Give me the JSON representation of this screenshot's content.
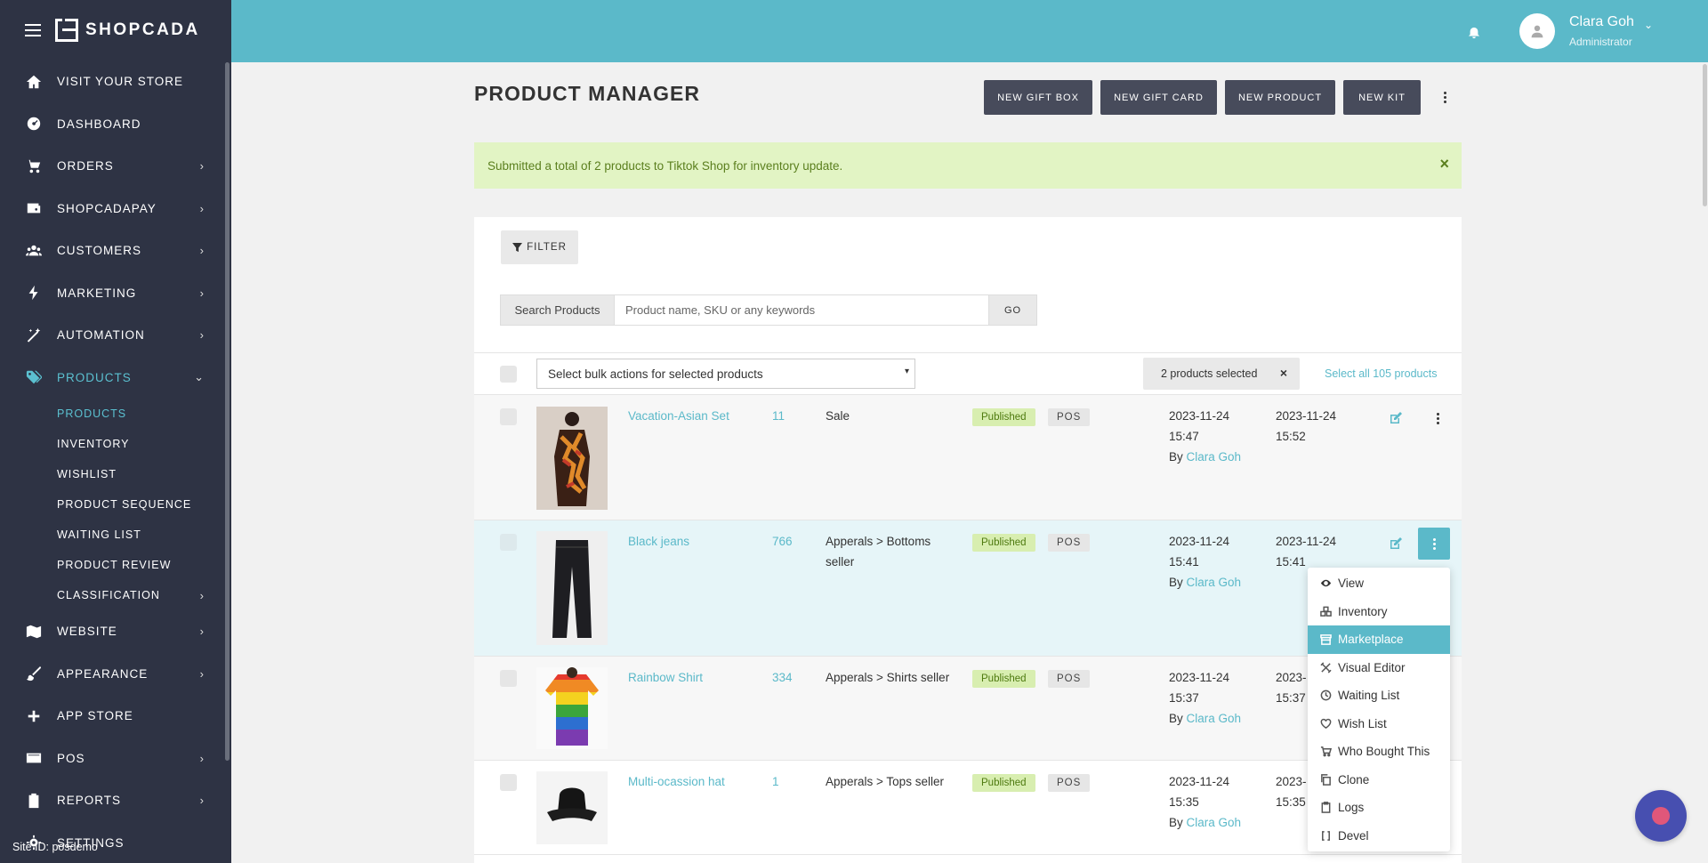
{
  "brand": {
    "name": "SHOPCADA"
  },
  "sidebar": {
    "items": [
      {
        "label": "VISIT YOUR STORE",
        "icon": "home-icon",
        "chevron": false
      },
      {
        "label": "DASHBOARD",
        "icon": "dashboard-icon",
        "chevron": false
      },
      {
        "label": "ORDERS",
        "icon": "cart-icon",
        "chevron": true
      },
      {
        "label": "SHOPCADAPAY",
        "icon": "wallet-icon",
        "chevron": true
      },
      {
        "label": "CUSTOMERS",
        "icon": "users-icon",
        "chevron": true
      },
      {
        "label": "MARKETING",
        "icon": "bolt-icon",
        "chevron": true
      },
      {
        "label": "AUTOMATION",
        "icon": "wand-icon",
        "chevron": true
      },
      {
        "label": "PRODUCTS",
        "icon": "tags-icon",
        "chevron": true,
        "active": true
      }
    ],
    "sub_items": [
      {
        "label": "PRODUCTS",
        "active": true
      },
      {
        "label": "INVENTORY"
      },
      {
        "label": "WISHLIST"
      },
      {
        "label": "PRODUCT SEQUENCE"
      },
      {
        "label": "WAITING LIST"
      },
      {
        "label": "PRODUCT REVIEW"
      },
      {
        "label": "CLASSIFICATION",
        "chevron": true
      }
    ],
    "items_after": [
      {
        "label": "WEBSITE",
        "icon": "map-icon",
        "chevron": true
      },
      {
        "label": "APPEARANCE",
        "icon": "brush-icon",
        "chevron": true
      },
      {
        "label": "APP STORE",
        "icon": "plus-icon",
        "chevron": false
      },
      {
        "label": "POS",
        "icon": "card-icon",
        "chevron": true
      },
      {
        "label": "REPORTS",
        "icon": "clipboard-icon",
        "chevron": true
      },
      {
        "label": "SETTINGS",
        "icon": "gear-icon",
        "chevron": false
      }
    ],
    "site_id": "Site ID: posdemo"
  },
  "header": {
    "user_name": "Clara Goh",
    "user_role": "Administrator"
  },
  "page": {
    "title": "PRODUCT MANAGER",
    "buttons": [
      "NEW GIFT BOX",
      "NEW GIFT CARD",
      "NEW PRODUCT",
      "NEW KIT"
    ],
    "alert": "Submitted a total of 2 products to Tiktok Shop for inventory update.",
    "alert_close": "×"
  },
  "filter": {
    "label": "FILTER"
  },
  "search": {
    "label": "Search Products",
    "placeholder": "Product name, SKU or any keywords",
    "go": "GO"
  },
  "bulk": {
    "placeholder": "Select bulk actions for selected products",
    "caret": "▾",
    "selected_label": "2 products selected",
    "selected_close": "×",
    "select_all": "Select all 105 products"
  },
  "products": [
    {
      "name": "Vacation-Asian Set",
      "qty": "11",
      "category": "Sale",
      "status": "Published",
      "channel": "POS",
      "created_date": "2023-11-24",
      "created_time": "15:47",
      "by_prefix": "By",
      "by": "Clara Goh",
      "updated_date": "2023-11-24",
      "updated_time": "15:52",
      "image": "dress-image"
    },
    {
      "name": "Black jeans",
      "qty": "766",
      "category": "Apperals > Bottoms seller",
      "status": "Published",
      "channel": "POS",
      "created_date": "2023-11-24",
      "created_time": "15:41",
      "by_prefix": "By",
      "by": "Clara Goh",
      "updated_date": "2023-11-24",
      "updated_time": "15:41",
      "image": "jeans-image"
    },
    {
      "name": "Rainbow Shirt",
      "qty": "334",
      "category": "Apperals > Shirts seller",
      "status": "Published",
      "channel": "POS",
      "created_date": "2023-11-24",
      "created_time": "15:37",
      "by_prefix": "By",
      "by": "Clara Goh",
      "updated_date": "2023-",
      "updated_time": "15:37",
      "image": "shirt-image"
    },
    {
      "name": "Multi-ocassion hat",
      "qty": "1",
      "category": "Apperals > Tops seller",
      "status": "Published",
      "channel": "POS",
      "created_date": "2023-11-24",
      "created_time": "15:35",
      "by_prefix": "By",
      "by": "Clara Goh",
      "updated_date": "2023-",
      "updated_time": "15:35",
      "image": "hat-image"
    }
  ],
  "row_menu": {
    "items": [
      {
        "label": "View",
        "icon": "eye-icon"
      },
      {
        "label": "Inventory",
        "icon": "boxes-icon"
      },
      {
        "label": "Marketplace",
        "icon": "store-icon",
        "active": true
      },
      {
        "label": "Visual Editor",
        "icon": "tools-icon"
      },
      {
        "label": "Waiting List",
        "icon": "clock-icon"
      },
      {
        "label": "Wish List",
        "icon": "heart-icon"
      },
      {
        "label": "Who Bought This",
        "icon": "cart-icon"
      },
      {
        "label": "Clone",
        "icon": "copy-icon"
      },
      {
        "label": "Logs",
        "icon": "clipboard-icon"
      },
      {
        "label": "Devel",
        "icon": "bracket-icon"
      }
    ]
  },
  "colors": {
    "accent": "#5bb9c9",
    "sidebar": "#2e3344",
    "button": "#474b5b",
    "alert_bg": "#e2f4c4"
  }
}
